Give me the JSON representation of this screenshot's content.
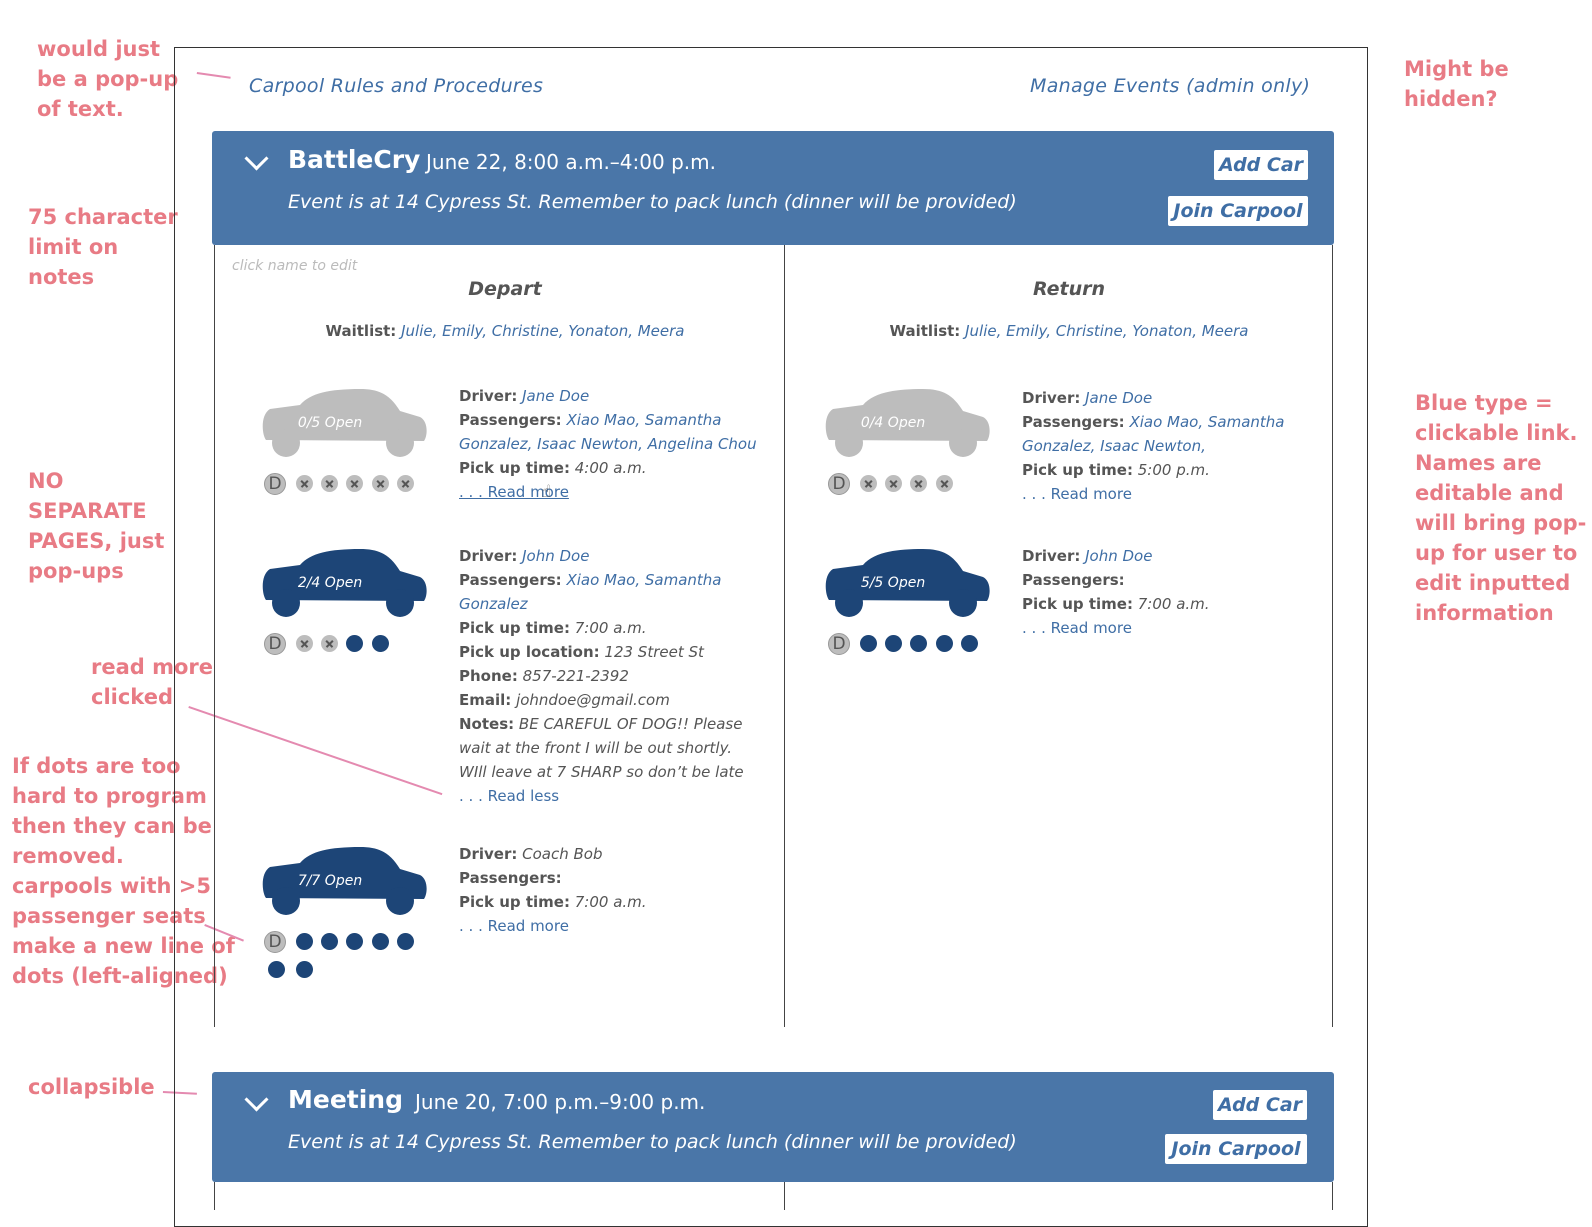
{
  "annotations": {
    "popup_text": "would just\nbe a pop-up\nof text.",
    "char_limit": "75 character\nlimit on\nnotes",
    "no_pages": "NO\nSEPARATE\nPAGES, just\npop-ups",
    "read_more": "read more\nclicked",
    "dots": "If dots are too\nhard to program\nthen they can be\nremoved.\ncarpools with >5\npassenger seats\nmake a new line of\ndots (left-aligned)",
    "collapsible": "collapsible",
    "hidden": "Might be\nhidden?",
    "blue_type": "Blue type =\nclickable link.\nNames are\neditable and\nwill bring pop-\nup for user to\nedit inputted\ninformation"
  },
  "top": {
    "rules_link": "Carpool Rules and Procedures",
    "manage_link": "Manage Events (admin only)"
  },
  "events": [
    {
      "title": "BattleCry",
      "date": "June 22, 8:00 a.m.–4:00 p.m.",
      "description": "Event is at 14 Cypress St. Remember to pack lunch (dinner will be provided)",
      "add_car": "Add Car",
      "join_carpool": "Join Carpool"
    },
    {
      "title": "Meeting",
      "date": "June 20, 7:00 p.m.–9:00 p.m.",
      "description": "Event is at 14 Cypress St. Remember to pack lunch (dinner will be provided)",
      "add_car": "Add Car",
      "join_carpool": "Join Carpool"
    }
  ],
  "hint": "click name to edit",
  "labels": {
    "waitlist": "Waitlist:",
    "driver": "Driver:",
    "passengers": "Passengers:",
    "pickup_time": "Pick up time:",
    "pickup_location": "Pick up location:",
    "phone": "Phone:",
    "email": "Email:",
    "notes": "Notes:",
    "read_more": ". . . Read more",
    "read_less": ". . . Read less"
  },
  "depart": {
    "heading": "Depart",
    "waitlist_names": "Julie, Emily, Christine, Yonaton, Meera",
    "cars": [
      {
        "status": "0/5 Open",
        "driver": "Jane Doe",
        "passengers": "Xiao Mao, Samantha Gonzalez, Isaac Newton, Angelina Chou",
        "pickup_time": "4:00 a.m."
      },
      {
        "status": "2/4 Open",
        "driver": "John Doe",
        "passengers": "Xiao Mao, Samantha Gonzalez",
        "pickup_time": "7:00 a.m.",
        "pickup_location": "123 Street St",
        "phone": "857-221-2392",
        "email": "johndoe@gmail.com",
        "notes": "BE CAREFUL OF DOG!! Please wait at the front I will be out shortly. WIll leave at 7 SHARP so don’t be late"
      },
      {
        "status": "7/7 Open",
        "driver": "Coach Bob",
        "passengers": "",
        "pickup_time": "7:00 a.m."
      }
    ]
  },
  "return": {
    "heading": "Return",
    "waitlist_names": "Julie, Emily, Christine, Yonaton, Meera",
    "cars": [
      {
        "status": "0/4 Open",
        "driver": "Jane Doe",
        "passengers": "Xiao Mao, Samantha Gonzalez, Isaac Newton,",
        "pickup_time": "5:00 p.m."
      },
      {
        "status": "5/5 Open",
        "driver": "John Doe",
        "passengers": "",
        "pickup_time": "7:00 a.m."
      }
    ]
  },
  "seat_dots": {
    "depart_car1": "D xxxxx",
    "depart_car2": "D xx••",
    "depart_car3": "D ••••• ••",
    "return_car1": "D xxxx",
    "return_car2": "D •••••"
  },
  "colors": {
    "header_blue": "#4a76a8",
    "car_blue": "#1d4577",
    "car_grey": "#bdbdbd",
    "annotation_pink": "#e87b85",
    "link_blue": "#3f6ea5"
  }
}
